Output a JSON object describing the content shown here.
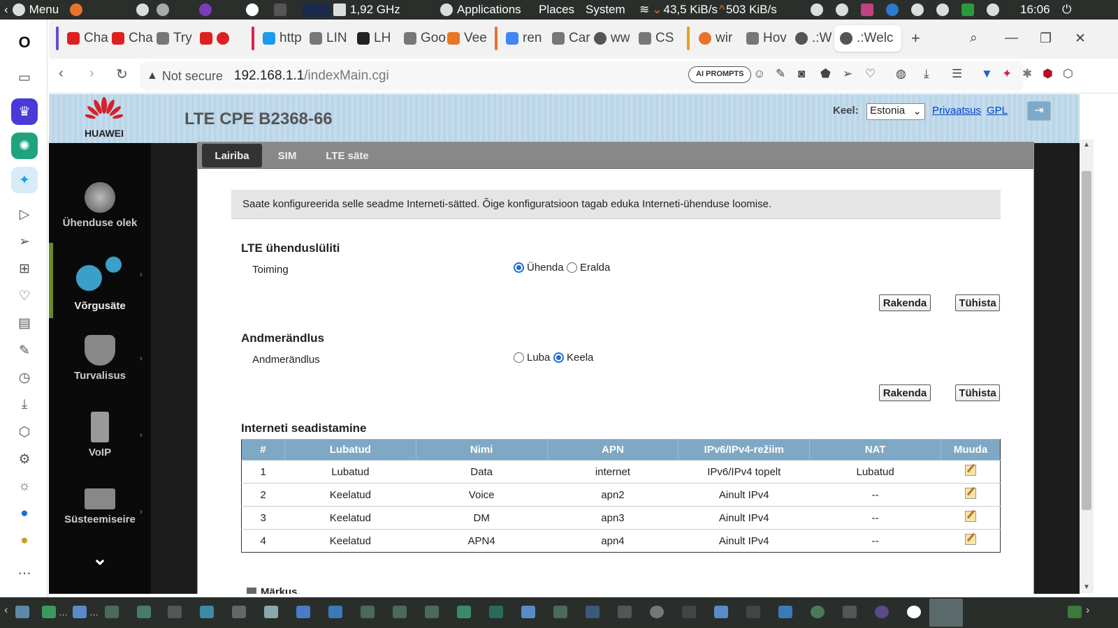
{
  "system_bar": {
    "menu_label": "Menu",
    "cpu_freq": "1,92 GHz",
    "applications": "Applications",
    "places": "Places",
    "system": "System",
    "net_down": "43,5 KiB/s",
    "net_up": "503 KiB/s",
    "clock": "16:06"
  },
  "browser": {
    "tabs": [
      {
        "label": "Cha",
        "icon": "youtube-icon",
        "color": "#e02020"
      },
      {
        "label": "Cha",
        "icon": "youtube-icon",
        "color": "#e02020"
      },
      {
        "label": "Try",
        "icon": "doc-icon",
        "color": "#777777"
      },
      {
        "label": "http",
        "icon": "twitter-icon",
        "color": "#1d9bf0"
      },
      {
        "label": "LIN",
        "icon": "doc-icon",
        "color": "#777777"
      },
      {
        "label": "LH",
        "icon": "lhv-icon",
        "color": "#222222"
      },
      {
        "label": "Goo",
        "icon": "doc-icon",
        "color": "#777777"
      },
      {
        "label": "Vee",
        "icon": "fox-icon",
        "color": "#e87722"
      },
      {
        "label": "ren",
        "icon": "google-icon",
        "color": "#4285f4"
      },
      {
        "label": "Car",
        "icon": "doc-icon",
        "color": "#777777"
      },
      {
        "label": "ww",
        "icon": "globe-icon",
        "color": "#555555"
      },
      {
        "label": "CS",
        "icon": "doc-icon",
        "color": "#777777"
      },
      {
        "label": "wir",
        "icon": "ask-icon",
        "color": "#e8732a"
      },
      {
        "label": "Hov",
        "icon": "doc-icon",
        "color": "#777777"
      },
      {
        "label": ".:W",
        "icon": "globe-icon",
        "color": "#555555"
      },
      {
        "label": ".:Welc",
        "icon": "globe-icon",
        "color": "#555555"
      }
    ],
    "address": {
      "security_label": "Not secure",
      "host": "192.168.1.1",
      "path": "/indexMain.cgi"
    },
    "ai_prompts_label": "AI PROMPTS"
  },
  "router": {
    "brand": "HUAWEI",
    "model": "LTE CPE B2368-66",
    "lang_label": "Keel:",
    "lang_value": "Estonia",
    "privacy_link": "Privaatsus",
    "gpl_link": "GPL",
    "nav": [
      {
        "label": "Ühenduse olek",
        "icon": "globe-icon"
      },
      {
        "label": "Võrgusäte",
        "icon": "gears-icon"
      },
      {
        "label": "Turvalisus",
        "icon": "shield-icon"
      },
      {
        "label": "VoIP",
        "icon": "phone-icon"
      },
      {
        "label": "Süsteemiseire",
        "icon": "monitor-icon"
      }
    ],
    "tabs": [
      "Lairiba",
      "SIM",
      "LTE säte"
    ],
    "info_text": "Saate konfigureerida selle seadme Interneti-sätted. Õige konfiguratsioon tagab eduka Interneti-ühenduse loomise.",
    "lte_switch": {
      "title": "LTE ühenduslüliti",
      "label": "Toiming",
      "opt_connect": "Ühenda",
      "opt_disconnect": "Eralda",
      "selected": "connect"
    },
    "roaming": {
      "title": "Andmerändlus",
      "label": "Andmerändlus",
      "opt_allow": "Luba",
      "opt_deny": "Keela",
      "selected": "deny"
    },
    "apply_label": "Rakenda",
    "cancel_label": "Tühista",
    "internet_setup": {
      "title": "Interneti seadistamine",
      "columns": [
        "#",
        "Lubatud",
        "Nimi",
        "APN",
        "IPv6/IPv4-režiim",
        "NAT",
        "Muuda"
      ],
      "rows": [
        [
          "1",
          "Lubatud",
          "Data",
          "internet",
          "IPv6/IPv4 topelt",
          "Lubatud"
        ],
        [
          "2",
          "Keelatud",
          "Voice",
          "apn2",
          "Ainult IPv4",
          "--"
        ],
        [
          "3",
          "Keelatud",
          "DM",
          "apn3",
          "Ainult IPv4",
          "--"
        ],
        [
          "4",
          "Keelatud",
          "APN4",
          "apn4",
          "Ainult IPv4",
          "--"
        ]
      ]
    },
    "note_label": "Märkus."
  }
}
